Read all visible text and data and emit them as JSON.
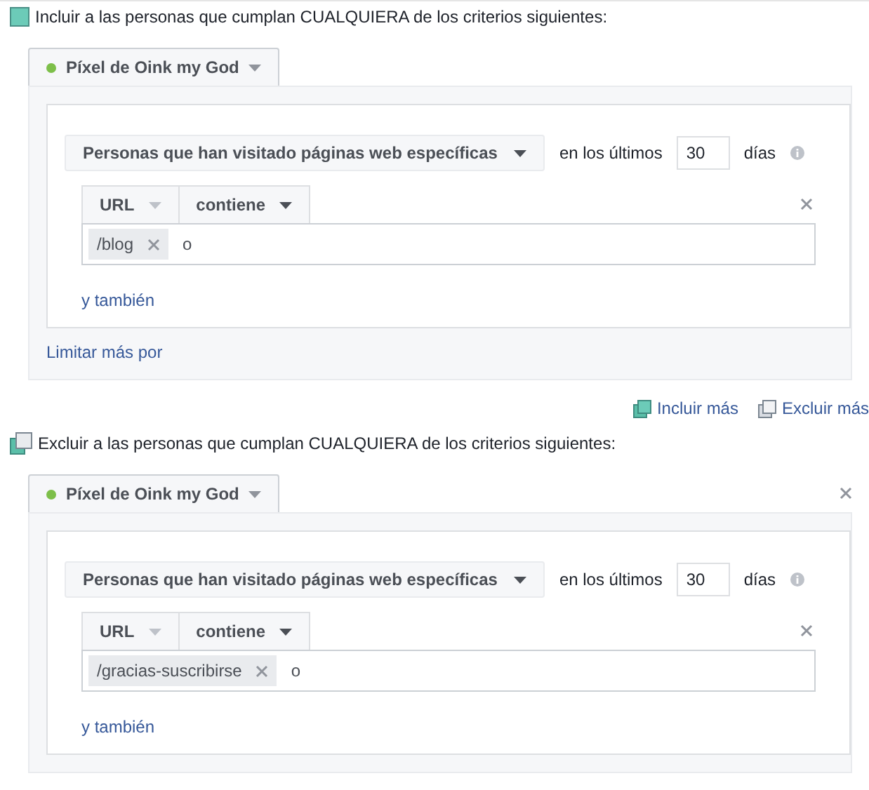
{
  "sections": [
    {
      "kind": "include",
      "heading": "Incluir a las personas que cumplan CUALQUIERA de los criterios siguientes:",
      "source": {
        "label": "Píxel de Oink my God",
        "color": "#7dbf4a"
      },
      "rule": {
        "event": "Personas que han visitado páginas web específicas",
        "within": "en los últimos",
        "days": "30",
        "unit": "días",
        "field": "URL",
        "operator": "contiene",
        "tags": [
          "/blog"
        ],
        "or_label": "o",
        "and_link": "y también"
      },
      "refine_link": "Limitar más por"
    },
    {
      "kind": "exclude",
      "heading": "Excluir a las personas que cumplan CUALQUIERA de los criterios siguientes:",
      "removable": true,
      "source": {
        "label": "Píxel de Oink my God",
        "color": "#7dbf4a"
      },
      "rule": {
        "event": "Personas que han visitado páginas web específicas",
        "within": "en los últimos",
        "days": "30",
        "unit": "días",
        "field": "URL",
        "operator": "contiene",
        "tags": [
          "/gracias-suscribirse"
        ],
        "or_label": "o",
        "and_link": "y también"
      }
    }
  ],
  "actions": [
    {
      "kind": "include",
      "label": "Incluir más"
    },
    {
      "kind": "exclude",
      "label": "Excluir más"
    }
  ]
}
